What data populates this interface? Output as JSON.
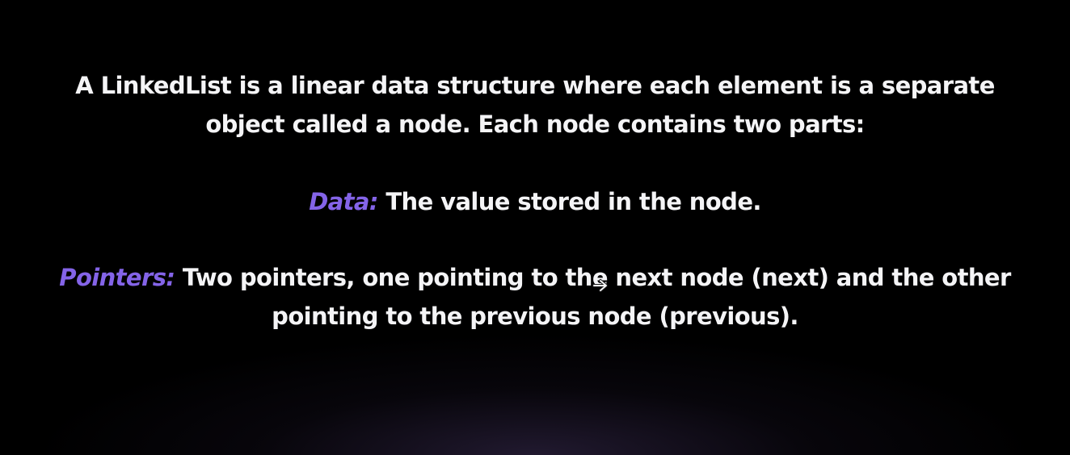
{
  "intro": {
    "line1": "A LinkedList is a linear data structure where each element is a separate",
    "line2": "object called a node. Each node contains two parts:"
  },
  "data_item": {
    "term": "Data:",
    "text": " The value stored in the node."
  },
  "pointers_item": {
    "term": "Pointers:",
    "line1": " Two pointers, one pointing to the next node (next) and the other",
    "line2": "pointing to the previous node (previous)."
  },
  "colors": {
    "background": "#000000",
    "text": "#f4f4f6",
    "accent": "#8464e8"
  },
  "icons": {
    "cursor": "arrow-cursor-icon"
  }
}
